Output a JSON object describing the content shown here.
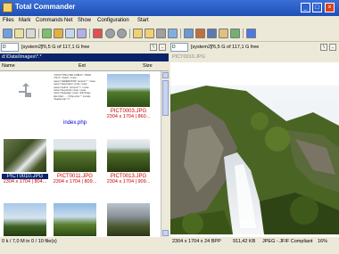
{
  "window": {
    "title": "Total Commander",
    "controls": [
      "_",
      "□",
      "×"
    ]
  },
  "menu": [
    "Files",
    "Mark",
    "Commands",
    "Net",
    "Show",
    "Configuration",
    "Start"
  ],
  "left_panel": {
    "drive": "D",
    "drive_label": "[system2]",
    "drive_info": "76,5 G of 117,1 G free",
    "path": "d:\\Data\\Images\\*.*",
    "columns": [
      "Name",
      "Ext",
      "Size"
    ],
    "items": [
      {
        "name": "",
        "meta": "",
        "kind": "up"
      },
      {
        "name": "index.php",
        "meta": "",
        "kind": "text"
      },
      {
        "name": "PICT0003.JPG",
        "meta": "2304 x 1704 | 860...",
        "kind": "photo"
      },
      {
        "name": "PICT0010.JPG",
        "meta": "2304 x 1704 | 804...",
        "kind": "photo",
        "selected": true
      },
      {
        "name": "PICT0011.JPG",
        "meta": "2304 x 1704 | 809...",
        "kind": "photo"
      },
      {
        "name": "PICT0013.JPG",
        "meta": "2304 x 1704 | 909...",
        "kind": "photo"
      },
      {
        "name": "",
        "meta": "",
        "kind": "photo"
      },
      {
        "name": "",
        "meta": "",
        "kind": "photo"
      },
      {
        "name": "",
        "meta": "",
        "kind": "photo"
      }
    ],
    "status": "0 k / 7,0 M in 0 / 10 file(s)"
  },
  "right_panel": {
    "drive": "D",
    "drive_label": "[system2]",
    "drive_info": "76,5 G of 117,1 G free",
    "path": "PICT0010.JPG",
    "status_dims": "2304 x 1704 x 24 BPP",
    "status_size": "911,42 KB",
    "status_format": "JPEG - JFIF Compliant",
    "status_zoom": "16%"
  },
  "text_preview": "<!DOCTYPE HTML PUBLIC \"-//W3C <html> <head> <meta name=\"GENERATOR\" content=\"\" <meta name=\"description\" conte <meta name=\"author\" content=\"\"> <meta name=\"keywords\" conte <meta name=\"language\" conte <title>Page title</title> ... <?php echo \"\"; include \"header.php\" ?>",
  "colors": {
    "title_bar": "#2456c8",
    "accent": "#cc0000",
    "selected": "#0a246a"
  },
  "icons": [
    "folder-up-icon",
    "image-viewer-icon",
    "refresh-icon",
    "back-icon",
    "forward-icon"
  ]
}
